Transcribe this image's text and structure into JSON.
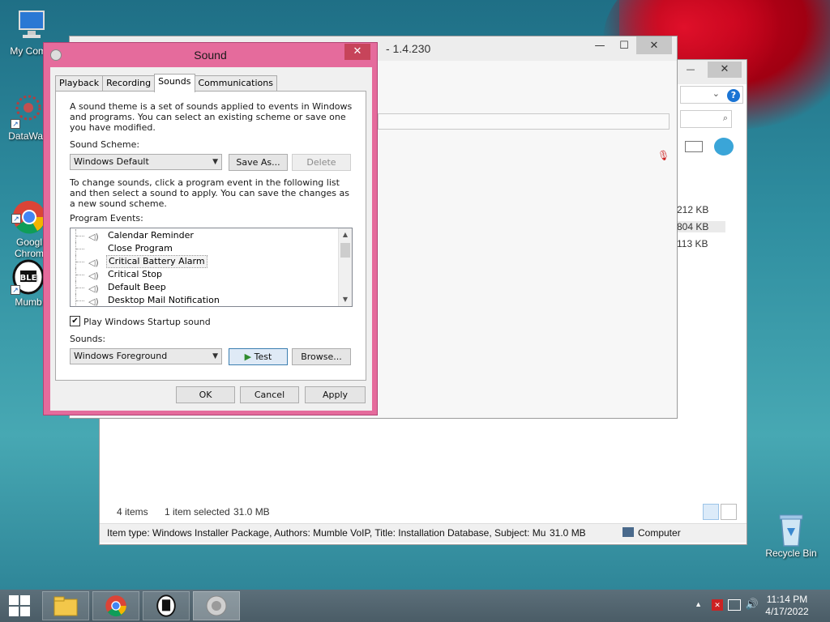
{
  "desktop": {
    "icons": [
      {
        "label": "My Comp",
        "icon": "computer-icon"
      },
      {
        "label": "DataWag",
        "icon": "datawag-icon"
      },
      {
        "label": "Googl\nChrom",
        "icon": "chrome-icon"
      },
      {
        "label": "Mumb",
        "icon": "mumble-icon"
      }
    ],
    "recycle_bin": "Recycle Bin"
  },
  "background_window": {
    "title_fragment": "- 1.4.230"
  },
  "explorer": {
    "sizes": [
      "212 KB",
      "804 KB",
      "113 KB"
    ],
    "status": {
      "items": "4 items",
      "selected": "1 item selected",
      "selected_size": "31.0 MB"
    },
    "details": {
      "text": "Item type: Windows Installer Package, Authors: Mumble VoIP, Title: Installation Database, Subject: Mun",
      "size": "31.0 MB",
      "location": "Computer"
    }
  },
  "sound_dialog": {
    "title": "Sound",
    "tabs": [
      "Playback",
      "Recording",
      "Sounds",
      "Communications"
    ],
    "active_tab": "Sounds",
    "intro": "A sound theme is a set of sounds applied to events in Windows and programs.  You can select an existing scheme or save one you have modified.",
    "scheme_label": "Sound Scheme:",
    "scheme_value": "Windows Default",
    "save_as": "Save As...",
    "delete": "Delete",
    "change_text": "To change sounds, click a program event in the following list and then select a sound to apply.  You can save the changes as a new sound scheme.",
    "events_label": "Program Events:",
    "events": [
      {
        "label": "Calendar Reminder",
        "has_sound": true,
        "selected": false
      },
      {
        "label": "Close Program",
        "has_sound": false,
        "selected": false
      },
      {
        "label": "Critical Battery Alarm",
        "has_sound": true,
        "selected": true
      },
      {
        "label": "Critical Stop",
        "has_sound": true,
        "selected": false
      },
      {
        "label": "Default Beep",
        "has_sound": true,
        "selected": false
      },
      {
        "label": "Desktop Mail Notification",
        "has_sound": true,
        "selected": false
      }
    ],
    "startup_checkbox": {
      "label": "Play Windows Startup sound",
      "checked": true
    },
    "sounds_label": "Sounds:",
    "sounds_value": "Windows Foreground",
    "test": "Test",
    "browse": "Browse...",
    "ok": "OK",
    "cancel": "Cancel",
    "apply": "Apply"
  },
  "taskbar": {
    "time": "11:14 PM",
    "date": "4/17/2022"
  },
  "colors": {
    "dialog_frame": "#e56b9c",
    "desktop": "#2f8ea0",
    "taskbar": "#4a5c66"
  }
}
